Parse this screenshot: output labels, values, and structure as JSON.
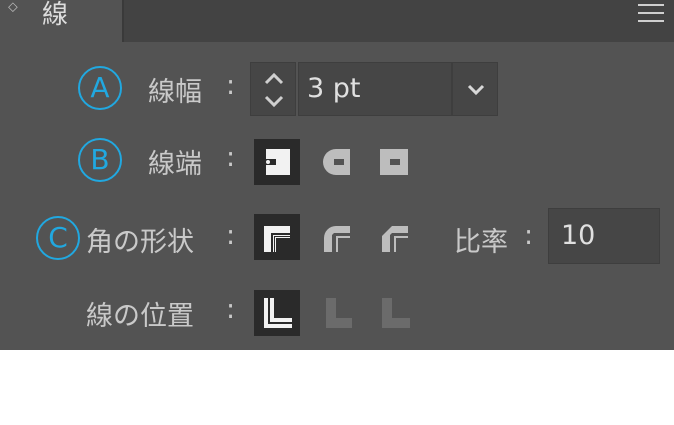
{
  "panel": {
    "title": "線",
    "menu_icon": "hamburger-menu-icon"
  },
  "rows": {
    "weight": {
      "badge": "A",
      "label": "線幅",
      "colon": ":",
      "value": "3 pt"
    },
    "cap": {
      "badge": "B",
      "label": "線端",
      "colon": ":",
      "options": [
        "butt-cap-icon",
        "round-cap-icon",
        "projecting-cap-icon"
      ],
      "selected": 0
    },
    "corner": {
      "badge": "C",
      "label": "角の形状",
      "colon": ":",
      "options": [
        "miter-join-icon",
        "round-join-icon",
        "bevel-join-icon"
      ],
      "selected": 0,
      "ratio_label": "比率",
      "ratio_colon": ":",
      "ratio_value": "10"
    },
    "align": {
      "label": "線の位置",
      "colon": ":",
      "options": [
        "align-center-icon",
        "align-inside-icon",
        "align-outside-icon"
      ],
      "selected": 0
    }
  },
  "colors": {
    "panel_bg": "#535353",
    "field_bg": "#464646",
    "selected_bg": "#2a2a2a",
    "badge": "#21a8e0",
    "text": "#c9c9c9"
  }
}
